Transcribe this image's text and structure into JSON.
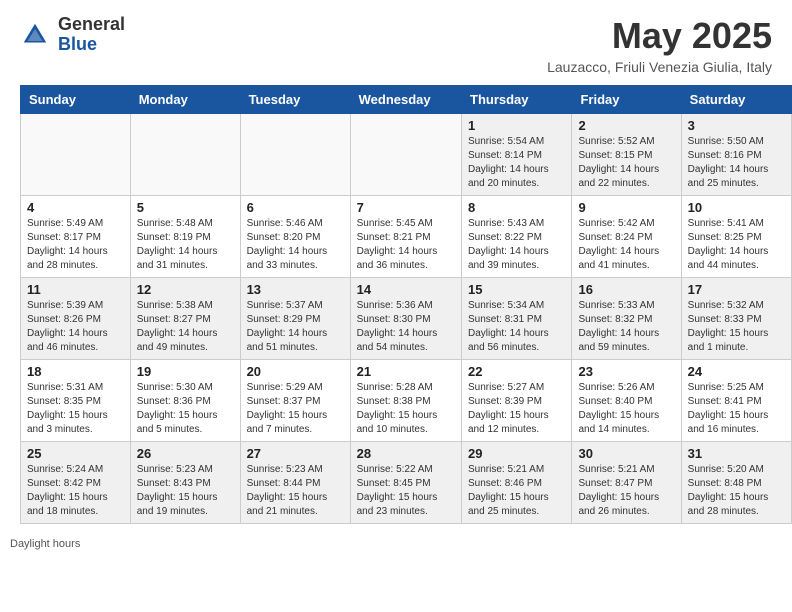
{
  "header": {
    "logo_general": "General",
    "logo_blue": "Blue",
    "month_title": "May 2025",
    "location": "Lauzacco, Friuli Venezia Giulia, Italy"
  },
  "days_of_week": [
    "Sunday",
    "Monday",
    "Tuesday",
    "Wednesday",
    "Thursday",
    "Friday",
    "Saturday"
  ],
  "weeks": [
    [
      {
        "day": "",
        "info": ""
      },
      {
        "day": "",
        "info": ""
      },
      {
        "day": "",
        "info": ""
      },
      {
        "day": "",
        "info": ""
      },
      {
        "day": "1",
        "info": "Sunrise: 5:54 AM\nSunset: 8:14 PM\nDaylight: 14 hours\nand 20 minutes."
      },
      {
        "day": "2",
        "info": "Sunrise: 5:52 AM\nSunset: 8:15 PM\nDaylight: 14 hours\nand 22 minutes."
      },
      {
        "day": "3",
        "info": "Sunrise: 5:50 AM\nSunset: 8:16 PM\nDaylight: 14 hours\nand 25 minutes."
      }
    ],
    [
      {
        "day": "4",
        "info": "Sunrise: 5:49 AM\nSunset: 8:17 PM\nDaylight: 14 hours\nand 28 minutes."
      },
      {
        "day": "5",
        "info": "Sunrise: 5:48 AM\nSunset: 8:19 PM\nDaylight: 14 hours\nand 31 minutes."
      },
      {
        "day": "6",
        "info": "Sunrise: 5:46 AM\nSunset: 8:20 PM\nDaylight: 14 hours\nand 33 minutes."
      },
      {
        "day": "7",
        "info": "Sunrise: 5:45 AM\nSunset: 8:21 PM\nDaylight: 14 hours\nand 36 minutes."
      },
      {
        "day": "8",
        "info": "Sunrise: 5:43 AM\nSunset: 8:22 PM\nDaylight: 14 hours\nand 39 minutes."
      },
      {
        "day": "9",
        "info": "Sunrise: 5:42 AM\nSunset: 8:24 PM\nDaylight: 14 hours\nand 41 minutes."
      },
      {
        "day": "10",
        "info": "Sunrise: 5:41 AM\nSunset: 8:25 PM\nDaylight: 14 hours\nand 44 minutes."
      }
    ],
    [
      {
        "day": "11",
        "info": "Sunrise: 5:39 AM\nSunset: 8:26 PM\nDaylight: 14 hours\nand 46 minutes."
      },
      {
        "day": "12",
        "info": "Sunrise: 5:38 AM\nSunset: 8:27 PM\nDaylight: 14 hours\nand 49 minutes."
      },
      {
        "day": "13",
        "info": "Sunrise: 5:37 AM\nSunset: 8:29 PM\nDaylight: 14 hours\nand 51 minutes."
      },
      {
        "day": "14",
        "info": "Sunrise: 5:36 AM\nSunset: 8:30 PM\nDaylight: 14 hours\nand 54 minutes."
      },
      {
        "day": "15",
        "info": "Sunrise: 5:34 AM\nSunset: 8:31 PM\nDaylight: 14 hours\nand 56 minutes."
      },
      {
        "day": "16",
        "info": "Sunrise: 5:33 AM\nSunset: 8:32 PM\nDaylight: 14 hours\nand 59 minutes."
      },
      {
        "day": "17",
        "info": "Sunrise: 5:32 AM\nSunset: 8:33 PM\nDaylight: 15 hours\nand 1 minute."
      }
    ],
    [
      {
        "day": "18",
        "info": "Sunrise: 5:31 AM\nSunset: 8:35 PM\nDaylight: 15 hours\nand 3 minutes."
      },
      {
        "day": "19",
        "info": "Sunrise: 5:30 AM\nSunset: 8:36 PM\nDaylight: 15 hours\nand 5 minutes."
      },
      {
        "day": "20",
        "info": "Sunrise: 5:29 AM\nSunset: 8:37 PM\nDaylight: 15 hours\nand 7 minutes."
      },
      {
        "day": "21",
        "info": "Sunrise: 5:28 AM\nSunset: 8:38 PM\nDaylight: 15 hours\nand 10 minutes."
      },
      {
        "day": "22",
        "info": "Sunrise: 5:27 AM\nSunset: 8:39 PM\nDaylight: 15 hours\nand 12 minutes."
      },
      {
        "day": "23",
        "info": "Sunrise: 5:26 AM\nSunset: 8:40 PM\nDaylight: 15 hours\nand 14 minutes."
      },
      {
        "day": "24",
        "info": "Sunrise: 5:25 AM\nSunset: 8:41 PM\nDaylight: 15 hours\nand 16 minutes."
      }
    ],
    [
      {
        "day": "25",
        "info": "Sunrise: 5:24 AM\nSunset: 8:42 PM\nDaylight: 15 hours\nand 18 minutes."
      },
      {
        "day": "26",
        "info": "Sunrise: 5:23 AM\nSunset: 8:43 PM\nDaylight: 15 hours\nand 19 minutes."
      },
      {
        "day": "27",
        "info": "Sunrise: 5:23 AM\nSunset: 8:44 PM\nDaylight: 15 hours\nand 21 minutes."
      },
      {
        "day": "28",
        "info": "Sunrise: 5:22 AM\nSunset: 8:45 PM\nDaylight: 15 hours\nand 23 minutes."
      },
      {
        "day": "29",
        "info": "Sunrise: 5:21 AM\nSunset: 8:46 PM\nDaylight: 15 hours\nand 25 minutes."
      },
      {
        "day": "30",
        "info": "Sunrise: 5:21 AM\nSunset: 8:47 PM\nDaylight: 15 hours\nand 26 minutes."
      },
      {
        "day": "31",
        "info": "Sunrise: 5:20 AM\nSunset: 8:48 PM\nDaylight: 15 hours\nand 28 minutes."
      }
    ]
  ],
  "footer": {
    "text": "Daylight hours"
  }
}
